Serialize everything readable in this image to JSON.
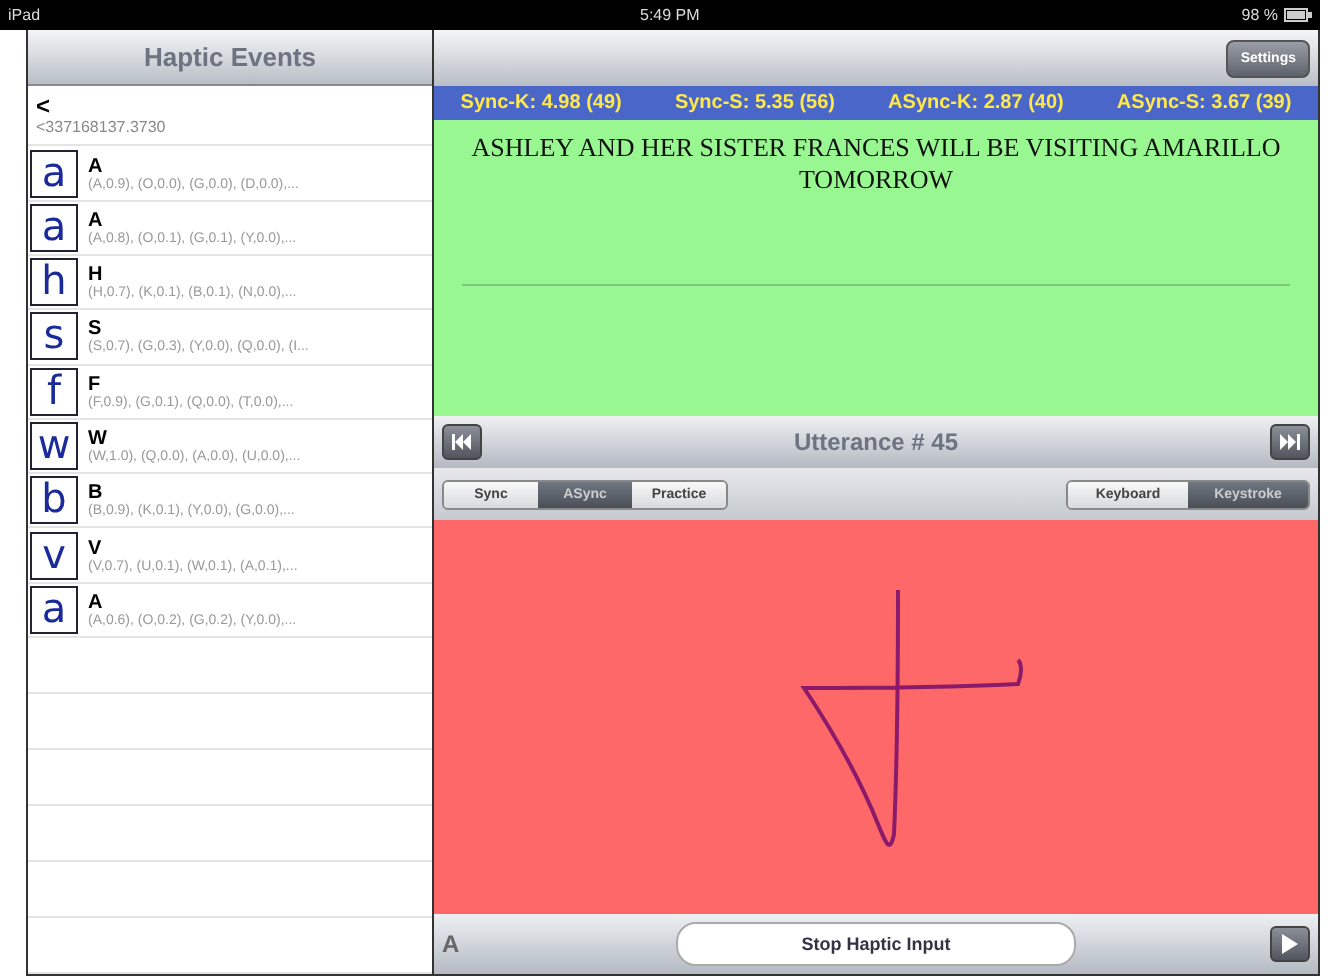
{
  "status_bar": {
    "device": "iPad",
    "time": "5:49 PM",
    "battery": "98 %"
  },
  "sidebar": {
    "title": "Haptic Events",
    "back": "<",
    "timestamp": "<337168137.3730",
    "items": [
      {
        "glyph": "a",
        "letter": "A",
        "detail": "(A,0.9), (O,0.0), (G,0.0), (D,0.0),..."
      },
      {
        "glyph": "a",
        "letter": "A",
        "detail": "(A,0.8), (O,0.1), (G,0.1), (Y,0.0),..."
      },
      {
        "glyph": "h",
        "letter": "H",
        "detail": "(H,0.7), (K,0.1), (B,0.1), (N,0.0),..."
      },
      {
        "glyph": "s",
        "letter": "S",
        "detail": "(S,0.7), (G,0.3), (Y,0.0), (Q,0.0), (I..."
      },
      {
        "glyph": "f",
        "letter": "F",
        "detail": "(F,0.9), (G,0.1), (Q,0.0), (T,0.0),..."
      },
      {
        "glyph": "w",
        "letter": "W",
        "detail": "(W,1.0), (Q,0.0), (A,0.0), (U,0.0),..."
      },
      {
        "glyph": "b",
        "letter": "B",
        "detail": "(B,0.9), (K,0.1), (Y,0.0), (G,0.0),..."
      },
      {
        "glyph": "v",
        "letter": "V",
        "detail": "(V,0.7), (U,0.1), (W,0.1), (A,0.1),..."
      },
      {
        "glyph": "a",
        "letter": "A",
        "detail": "(A,0.6), (O,0.2), (G,0.2), (Y,0.0),..."
      }
    ]
  },
  "toolbar": {
    "settings": "Settings"
  },
  "scores": [
    "Sync-K: 4.98 (49)",
    "Sync-S: 5.35 (56)",
    "ASync-K: 2.87 (40)",
    "ASync-S: 3.67 (39)"
  ],
  "sentence": "ASHLEY AND HER SISTER FRANCES WILL BE VISITING AMARILLO TOMORROW",
  "utterance": "Utterance # 45",
  "modes": [
    {
      "label": "Sync",
      "selected": false
    },
    {
      "label": "ASync",
      "selected": true
    },
    {
      "label": "Practice",
      "selected": false
    }
  ],
  "inputs": [
    {
      "label": "Keyboard",
      "selected": false
    },
    {
      "label": "Keystroke",
      "selected": true
    }
  ],
  "bottom_bar": {
    "recognized": "A",
    "button": "Stop Haptic Input"
  }
}
